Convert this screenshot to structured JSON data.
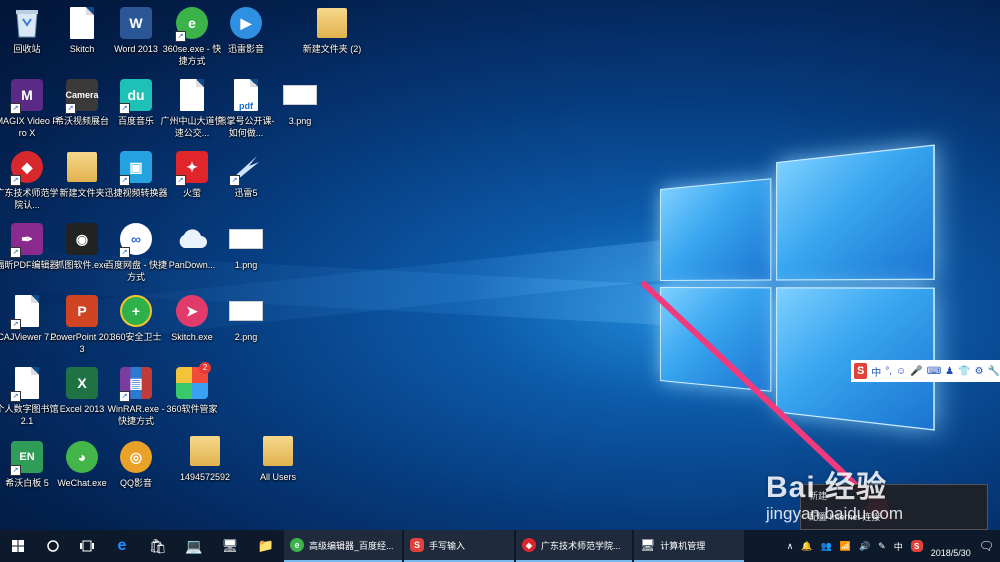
{
  "desktop": {
    "icons": [
      {
        "label": "回收站",
        "icon": "recycle-bin-icon"
      },
      {
        "label": "Skitch",
        "icon": "file-icon"
      },
      {
        "label": "Word 2013",
        "icon": "word-icon"
      },
      {
        "label": "360se.exe - 快捷方式",
        "icon": "360-browser-icon"
      },
      {
        "label": "迅雷影音",
        "icon": "xunlei-player-icon"
      },
      {
        "label": "新建文件夹 (2)",
        "icon": "folder-icon"
      },
      {
        "label": "MAGIX Video Pro X",
        "icon": "magix-icon"
      },
      {
        "label": "希沃视频展台",
        "icon": "camera-icon"
      },
      {
        "label": "百度音乐",
        "icon": "baidu-music-icon"
      },
      {
        "label": "广州中山大道快速公交...",
        "icon": "file-icon"
      },
      {
        "label": "熊掌号公开课-如何做...",
        "icon": "pdf-icon"
      },
      {
        "label": "3.png",
        "icon": "image-icon"
      },
      {
        "label": "广东技术师范学院认...",
        "icon": "app-icon"
      },
      {
        "label": "新建文件夹",
        "icon": "folder-icon"
      },
      {
        "label": "迅捷视频转换器",
        "icon": "video-converter-icon"
      },
      {
        "label": "火萤",
        "icon": "huoying-icon"
      },
      {
        "label": "迅雷5",
        "icon": "xunlei-icon"
      },
      {
        "label": "福昕PDF编辑器",
        "icon": "foxit-icon"
      },
      {
        "label": "抓图软件.exe",
        "icon": "capture-icon"
      },
      {
        "label": "百度网盘 - 快捷方式",
        "icon": "baidu-netdisk-icon"
      },
      {
        "label": "PanDown...",
        "icon": "cloud-icon"
      },
      {
        "label": "1.png",
        "icon": "image-icon"
      },
      {
        "label": "CAJViewer 7.2",
        "icon": "file-icon"
      },
      {
        "label": "PowerPoint 2013",
        "icon": "powerpoint-icon"
      },
      {
        "label": "360安全卫士",
        "icon": "360-safe-icon"
      },
      {
        "label": "Skitch.exe",
        "icon": "skitch-icon"
      },
      {
        "label": "2.png",
        "icon": "image-icon"
      },
      {
        "label": "个人数字图书馆2.1",
        "icon": "file-icon"
      },
      {
        "label": "Excel 2013",
        "icon": "excel-icon"
      },
      {
        "label": "WinRAR.exe - 快捷方式",
        "icon": "winrar-icon"
      },
      {
        "label": "360软件管家",
        "icon": "360-manager-icon"
      },
      {
        "label": "希沃白板 5",
        "icon": "easinote-icon"
      },
      {
        "label": "WeChat.exe",
        "icon": "wechat-icon"
      },
      {
        "label": "QQ影音",
        "icon": "qq-player-icon"
      },
      {
        "label": "1494572592",
        "icon": "folder-icon"
      },
      {
        "label": "All Users",
        "icon": "folder-icon"
      }
    ],
    "icon_glyphs": {
      "word": "W",
      "pdf": "pdf",
      "camera": "Camera",
      "du": "du",
      "en": "EN",
      "ppt": "P",
      "xls": "X",
      "badge": "2"
    }
  },
  "ime_bar": {
    "brand": "S",
    "lang": "中",
    "punct": "°,"
  },
  "popup": {
    "line1": "新建",
    "line2": "配置 Internet 连接"
  },
  "watermark": {
    "brand": "Bai 经验",
    "url": "jingyan.baidu.com"
  },
  "taskbar": {
    "apps": [
      {
        "label": "高级编辑器_百度经...",
        "icon": "360-browser-icon",
        "color": "#3bb34a"
      },
      {
        "label": "手写输入",
        "icon": "sogou-icon",
        "color": "#e2403a"
      },
      {
        "label": "广东技术师范学院...",
        "icon": "app-icon",
        "color": "#d8282e"
      },
      {
        "label": "计算机管理",
        "icon": "computer-management-icon",
        "color": "#4a90d9"
      }
    ],
    "tray": {
      "ime": "中",
      "date": "2018/5/30"
    }
  },
  "colors": {
    "accent": "#76b9ed",
    "arrow": "#f03a7d"
  }
}
